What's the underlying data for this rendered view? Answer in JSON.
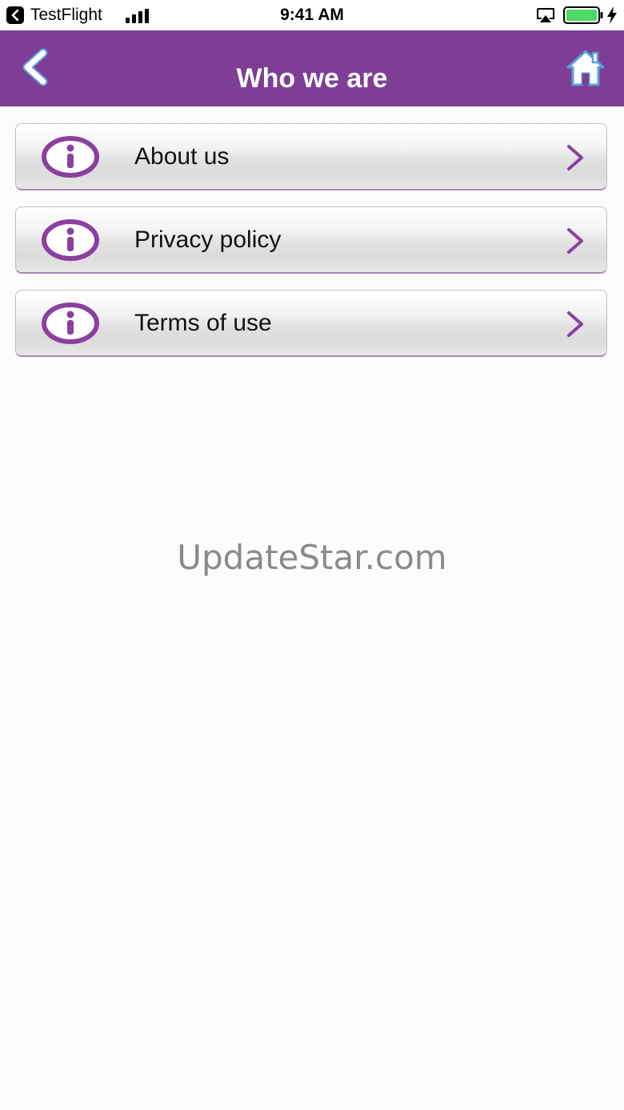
{
  "status_bar": {
    "back_app_label": "TestFlight",
    "time": "9:41 AM"
  },
  "header": {
    "title": "Who we are",
    "background_color": "#7e3e96"
  },
  "menu": {
    "items": [
      {
        "label": "About us",
        "icon": "info-icon"
      },
      {
        "label": "Privacy policy",
        "icon": "info-icon"
      },
      {
        "label": "Terms of use",
        "icon": "info-icon"
      }
    ],
    "accent_color": "#8b3fa0"
  },
  "watermark": {
    "text": "UpdateStar.com"
  }
}
